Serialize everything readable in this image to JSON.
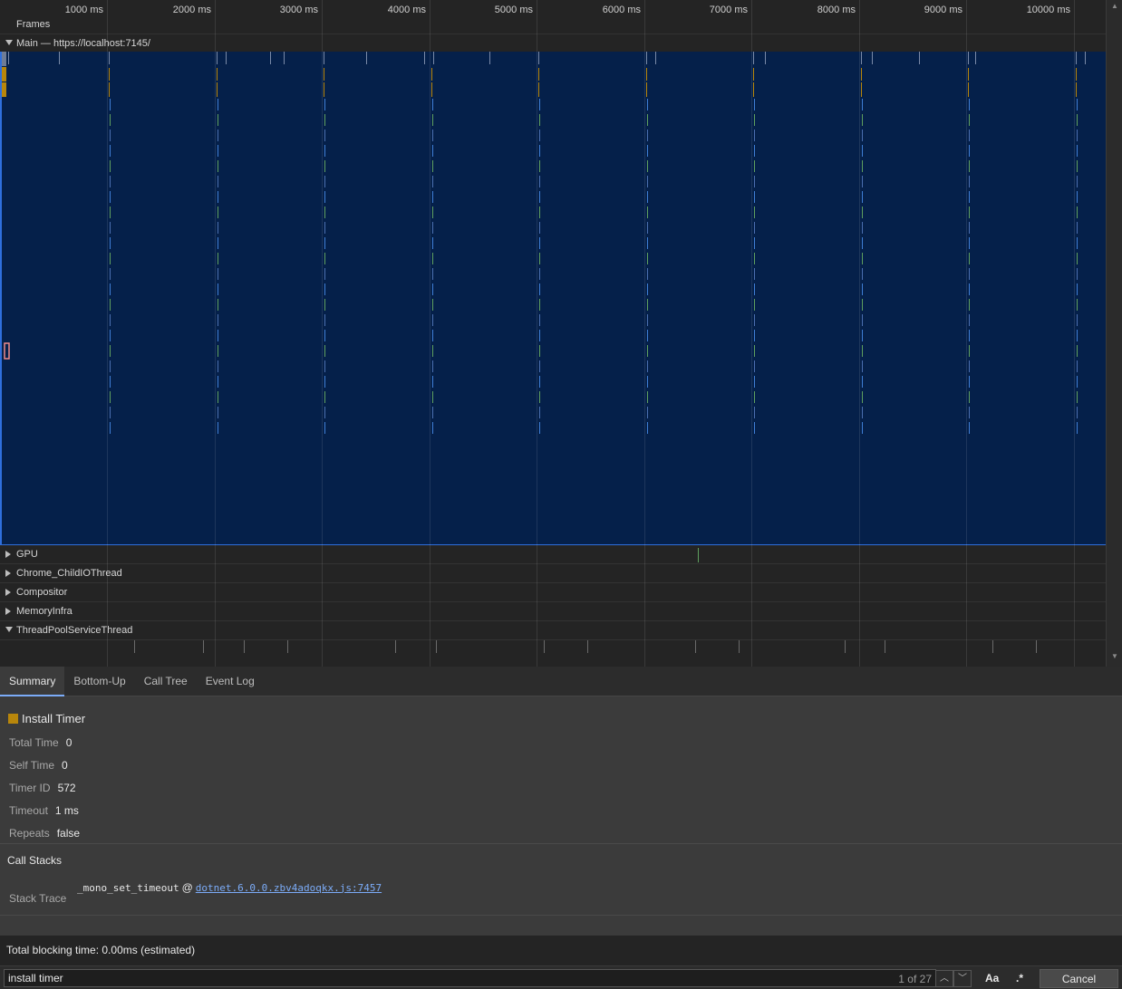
{
  "ruler": {
    "ticks": [
      "1000 ms",
      "2000 ms",
      "3000 ms",
      "4000 ms",
      "5000 ms",
      "6000 ms",
      "7000 ms",
      "8000 ms",
      "9000 ms",
      "10000 ms"
    ]
  },
  "tracks": {
    "frames": "Frames",
    "main": "Main — https://localhost:7145/",
    "gpu": "GPU",
    "childio": "Chrome_ChildIOThread",
    "compositor": "Compositor",
    "memory": "MemoryInfra",
    "threadpool": "ThreadPoolServiceThread"
  },
  "tabs": [
    "Summary",
    "Bottom-Up",
    "Call Tree",
    "Event Log"
  ],
  "summary": {
    "title": "Install Timer",
    "swatch_color": "#b8860b",
    "fields": [
      {
        "key": "Total Time",
        "value": "0"
      },
      {
        "key": "Self Time",
        "value": "0"
      },
      {
        "key": "Timer ID",
        "value": "572"
      },
      {
        "key": "Timeout",
        "value": "1 ms"
      },
      {
        "key": "Repeats",
        "value": "false"
      }
    ]
  },
  "call_stacks": {
    "heading": "Call Stacks",
    "stack_trace_label": "Stack Trace",
    "function": "_mono_set_timeout",
    "at": "@",
    "link": "dotnet.6.0.0.zbv4adoqkx.js:7457"
  },
  "footer": {
    "status": "Total blocking time: 0.00ms (estimated)"
  },
  "search": {
    "value": "install timer",
    "count": "1 of 27",
    "case_label": "Aa",
    "regex_label": ".*",
    "cancel_label": "Cancel"
  },
  "colors": {
    "main_track_bg": "#05204a",
    "accent": "#7cacf8"
  }
}
